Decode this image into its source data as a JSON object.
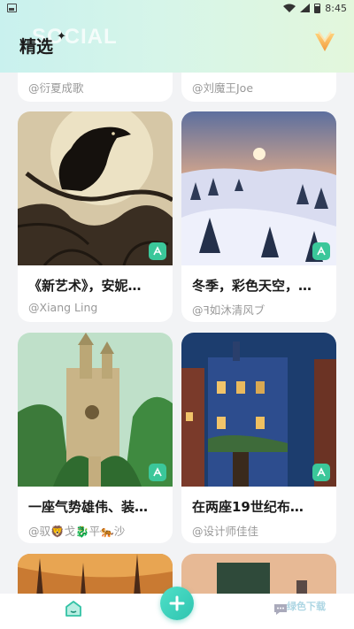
{
  "status_bar": {
    "time": "8:45"
  },
  "header": {
    "title": "精选",
    "ghost_text": "SOCIAL"
  },
  "cards": [
    {
      "title": "",
      "author": "@衍夏成歌"
    },
    {
      "title": "",
      "author": "@刘魔王Joe"
    },
    {
      "title": "《新艺术》，安妮…",
      "author": "@Xiang Ling"
    },
    {
      "title": "冬季，彩色天空，…",
      "author": "@ꟻ如沐清风ブ"
    },
    {
      "title": "一座气势雄伟、装…",
      "author": "@驭🦁戈🐉平🐅沙"
    },
    {
      "title": "在两座19世纪布…",
      "author": "@设计师佳佳"
    }
  ],
  "watermark": "绿色下载",
  "colors": {
    "accent": "#3bc79a",
    "header_start": "#c9f1ee",
    "header_end": "#e3f7dc"
  }
}
